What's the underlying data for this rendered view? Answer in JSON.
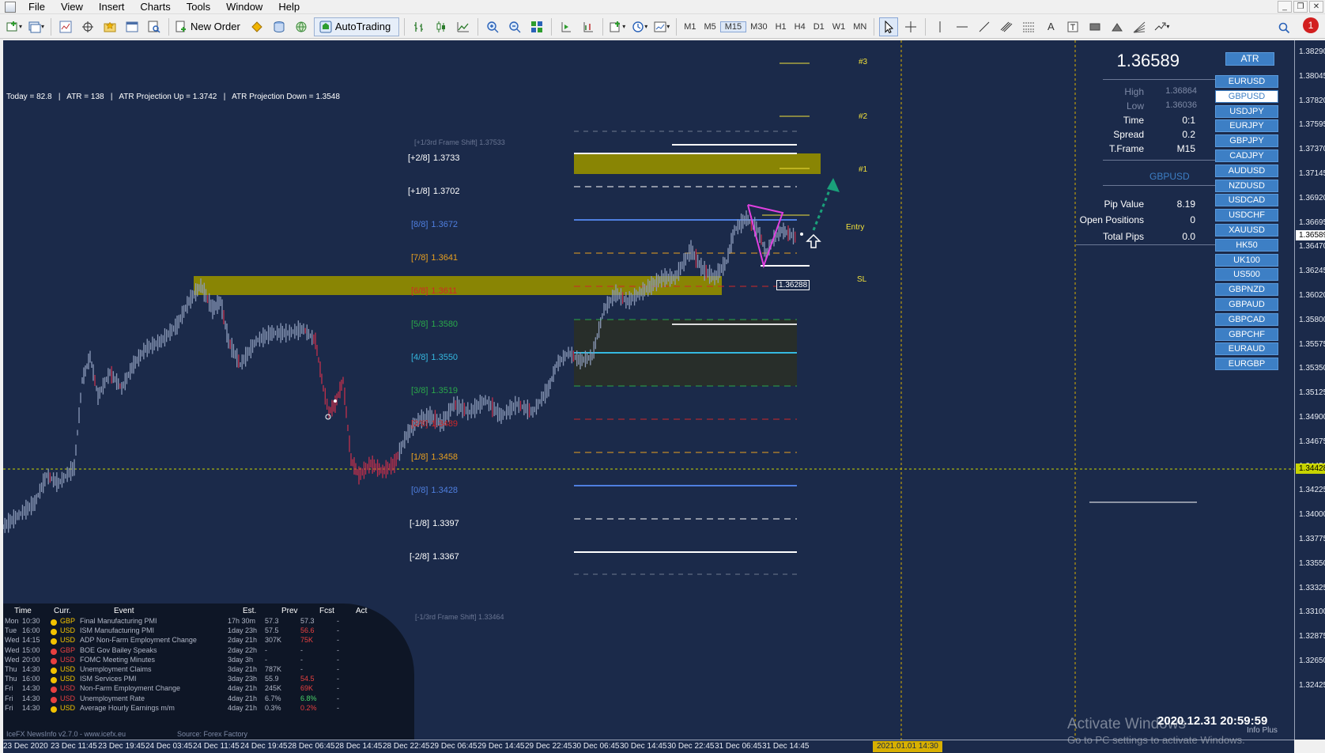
{
  "menu": [
    "File",
    "View",
    "Insert",
    "Charts",
    "Tools",
    "Window",
    "Help"
  ],
  "toolbar": {
    "new_order": "New Order",
    "autotrading": "AutoTrading",
    "timeframes": [
      "M1",
      "M5",
      "M15",
      "M30",
      "H1",
      "H4",
      "D1",
      "W1",
      "MN"
    ],
    "active_timeframe": "M15"
  },
  "notification_count": "1",
  "info_line": "Today = 82.8   |   ATR = 138   |   ATR Projection Up = 1.3742   |   ATR Projection Down = 1.3548",
  "murrey": [
    {
      "label": "[+2/8]",
      "value": "1.3733",
      "color": "#ffffff"
    },
    {
      "label": "[+1/8]",
      "value": "1.3702",
      "color": "#ffffff"
    },
    {
      "label": "[8/8]",
      "value": "1.3672",
      "color": "#4f7fe0"
    },
    {
      "label": "[7/8]",
      "value": "1.3641",
      "color": "#e8a020"
    },
    {
      "label": "[6/8]",
      "value": "1.3611",
      "color": "#d02828"
    },
    {
      "label": "[5/8]",
      "value": "1.3580",
      "color": "#2aa84a"
    },
    {
      "label": "[4/8]",
      "value": "1.3550",
      "color": "#35b8e0"
    },
    {
      "label": "[3/8]",
      "value": "1.3519",
      "color": "#2aa84a"
    },
    {
      "label": "[2/8]",
      "value": "1.3489",
      "color": "#d02828"
    },
    {
      "label": "[1/8]",
      "value": "1.3458",
      "color": "#e8a020"
    },
    {
      "label": "[0/8]",
      "value": "1.3428",
      "color": "#4f7fe0"
    },
    {
      "label": "[-1/8]",
      "value": "1.3397",
      "color": "#ffffff"
    },
    {
      "label": "[-2/8]",
      "value": "1.3367",
      "color": "#ffffff"
    }
  ],
  "frame_shift_top": "[+1/3rd Frame Shift]  1.37533",
  "frame_shift_bottom": "[-1/3rd Frame Shift]  1.33464",
  "targets": [
    "#3",
    "#2",
    "#1"
  ],
  "entry_label": "Entry",
  "sl_label": "SL",
  "sl_price": "1.36288",
  "panel": {
    "atr_button": "ATR",
    "price": "1.36589",
    "high_label": "High",
    "high": "1.36864",
    "low_label": "Low",
    "low": "1.36036",
    "time_label": "Time",
    "time": "0:1",
    "spread_label": "Spread",
    "spread": "0.2",
    "tframe_label": "T.Frame",
    "tframe": "M15",
    "symbol": "GBPUSD",
    "pip_value_label": "Pip Value",
    "pip_value": "8.19",
    "open_positions_label": "Open Positions",
    "open_positions": "0",
    "total_pips_label": "Total Pips",
    "total_pips": "0.0",
    "symbols": [
      "EURUSD",
      "GBPUSD",
      "USDJPY",
      "EURJPY",
      "GBPJPY",
      "CADJPY",
      "AUDUSD",
      "NZDUSD",
      "USDCAD",
      "USDCHF",
      "XAUUSD",
      "HK50",
      "UK100",
      "US500",
      "GBPNZD",
      "GBPAUD",
      "GBPCAD",
      "GBPCHF",
      "EURAUD",
      "EURGBP"
    ],
    "active_symbol": "GBPUSD"
  },
  "price_axis": [
    "1.38290",
    "1.38045",
    "1.37820",
    "1.37595",
    "1.37370",
    "1.37145",
    "1.36920",
    "1.36695",
    "1.36470",
    "1.36245",
    "1.36020",
    "1.35800",
    "1.35575",
    "1.35350",
    "1.35125",
    "1.34900",
    "1.34675",
    "1.34450",
    "1.34225",
    "1.34000",
    "1.33775",
    "1.33550",
    "1.33325",
    "1.33100",
    "1.32875",
    "1.32650",
    "1.32425"
  ],
  "price_axis_current": "1.36589",
  "price_axis_crosshair": "1.34428",
  "time_axis": [
    "23 Dec 2020",
    "23 Dec 11:45",
    "23 Dec 19:45",
    "24 Dec 03:45",
    "24 Dec 11:45",
    "24 Dec 19:45",
    "28 Dec 06:45",
    "28 Dec 14:45",
    "28 Dec 22:45",
    "29 Dec 06:45",
    "29 Dec 14:45",
    "29 Dec 22:45",
    "30 Dec 06:45",
    "30 Dec 14:45",
    "30 Dec 22:45",
    "31 Dec 06:45",
    "31 Dec 14:45"
  ],
  "time_axis_crosshair": "2021.01.01 14:30",
  "news": {
    "headers": [
      "Time",
      "Curr.",
      "Event",
      "Est.",
      "Prev",
      "Fcst",
      "Act"
    ],
    "rows": [
      {
        "day": "Mon",
        "time": "10:30",
        "curr": "GBP",
        "dot": "#f2c200",
        "event": "Final Manufacturing PMI",
        "est": "17h 30m",
        "prev": "57.3",
        "fcst": "57.3",
        "fcst_color": "#b0b6c6",
        "act": "-"
      },
      {
        "day": "Tue",
        "time": "16:00",
        "curr": "USD",
        "dot": "#f2c200",
        "event": "ISM Manufacturing PMI",
        "est": "1day 23h",
        "prev": "57.5",
        "fcst": "56.6",
        "fcst_color": "#e84040",
        "act": "-"
      },
      {
        "day": "Wed",
        "time": "14:15",
        "curr": "USD",
        "dot": "#f2c200",
        "event": "ADP Non-Farm Employment Change",
        "est": "2day 21h",
        "prev": "307K",
        "fcst": "75K",
        "fcst_color": "#e84040",
        "act": "-"
      },
      {
        "day": "Wed",
        "time": "15:00",
        "curr": "GBP",
        "dot": "#e84040",
        "event": "BOE Gov Bailey Speaks",
        "est": "2day 22h",
        "prev": "-",
        "fcst": "-",
        "fcst_color": "#b0b6c6",
        "act": "-"
      },
      {
        "day": "Wed",
        "time": "20:00",
        "curr": "USD",
        "dot": "#e84040",
        "event": "FOMC Meeting Minutes",
        "est": "3day 3h",
        "prev": "-",
        "fcst": "-",
        "fcst_color": "#b0b6c6",
        "act": "-"
      },
      {
        "day": "Thu",
        "time": "14:30",
        "curr": "USD",
        "dot": "#f2c200",
        "event": "Unemployment Claims",
        "est": "3day 21h",
        "prev": "787K",
        "fcst": "-",
        "fcst_color": "#b0b6c6",
        "act": "-"
      },
      {
        "day": "Thu",
        "time": "16:00",
        "curr": "USD",
        "dot": "#f2c200",
        "event": "ISM Services PMI",
        "est": "3day 23h",
        "prev": "55.9",
        "fcst": "54.5",
        "fcst_color": "#e84040",
        "act": "-"
      },
      {
        "day": "Fri",
        "time": "14:30",
        "curr": "USD",
        "dot": "#e84040",
        "event": "Non-Farm Employment Change",
        "est": "4day 21h",
        "prev": "245K",
        "fcst": "69K",
        "fcst_color": "#e84040",
        "act": "-"
      },
      {
        "day": "Fri",
        "time": "14:30",
        "curr": "USD",
        "dot": "#e84040",
        "event": "Unemployment Rate",
        "est": "4day 21h",
        "prev": "6.7%",
        "fcst": "6.8%",
        "fcst_color": "#4ad46a",
        "act": "-"
      },
      {
        "day": "Fri",
        "time": "14:30",
        "curr": "USD",
        "dot": "#f2c200",
        "event": "Average Hourly Earnings m/m",
        "est": "4day 21h",
        "prev": "0.3%",
        "fcst": "0.2%",
        "fcst_color": "#e84040",
        "act": "-"
      }
    ],
    "footer_left": "IceFX NewsInfo v2.7.0  -  www.icefx.eu",
    "footer_right": "Source: Forex Factory"
  },
  "datetime": "2020.12.31 20:59:59",
  "activate_windows": "Activate Windows",
  "activate_windows_sub": "Go to PC settings to activate Windows.",
  "info_plus": "Info Plus",
  "colors": {
    "chart_bg": "#1b2a4a",
    "bull": "#8b9ab8",
    "bear": "#c0304c",
    "zone": "#8f8a00",
    "crosshair": "#c8d400"
  }
}
